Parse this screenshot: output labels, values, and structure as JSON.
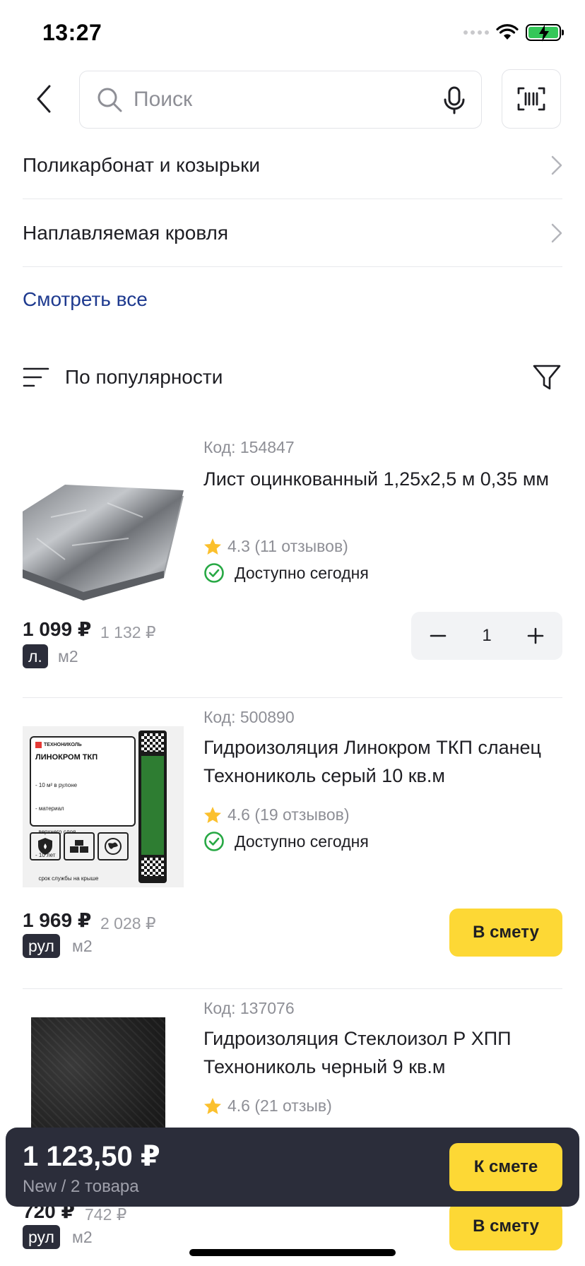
{
  "status_bar": {
    "time": "13:27"
  },
  "search": {
    "placeholder": "Поиск"
  },
  "categories": [
    {
      "label": "Поликарбонат и козырьки"
    },
    {
      "label": "Наплавляемая кровля"
    }
  ],
  "see_all": "Смотреть все",
  "sort": {
    "label": "По популярности"
  },
  "products": [
    {
      "code": "Код: 154847",
      "title": "Лист оцинкованный 1,25х2,5 м 0,35 мм",
      "rating": "4.3 (11 отзывов)",
      "availability": "Доступно сегодня",
      "price": "1 099 ₽",
      "old_price": "1 132 ₽",
      "unit": "л.",
      "unit_alt": "м2",
      "quantity": "1"
    },
    {
      "code": "Код: 500890",
      "title": "Гидроизоляция Линокром ТКП сланец Технониколь серый 10 кв.м",
      "rating": "4.6 (19 отзывов)",
      "availability": "Доступно сегодня",
      "price": "1 969 ₽",
      "old_price": "2 028 ₽",
      "unit": "рул",
      "unit_alt": "м2",
      "button": "В смету",
      "image_text": {
        "brand": "ТЕХНОНИКОЛЬ",
        "name": "ЛИНОКРОМ ТКП",
        "features": [
          "- 10 м² в рулоне",
          "- материал",
          "  верхнего слоя",
          "- 10 лет",
          "  срок службы на крыше"
        ]
      }
    },
    {
      "code": "Код: 137076",
      "title": "Гидроизоляция Стеклоизол Р ХПП Технониколь черный 9 кв.м",
      "rating": "4.6 (21 отзыв)",
      "price": "720 ₽",
      "old_price": "742 ₽",
      "unit": "рул",
      "unit_alt": "м2",
      "button": "В смету"
    }
  ],
  "summary": {
    "total": "1 123,50 ₽",
    "subtitle": "New / 2 товара",
    "button": "К смете"
  }
}
